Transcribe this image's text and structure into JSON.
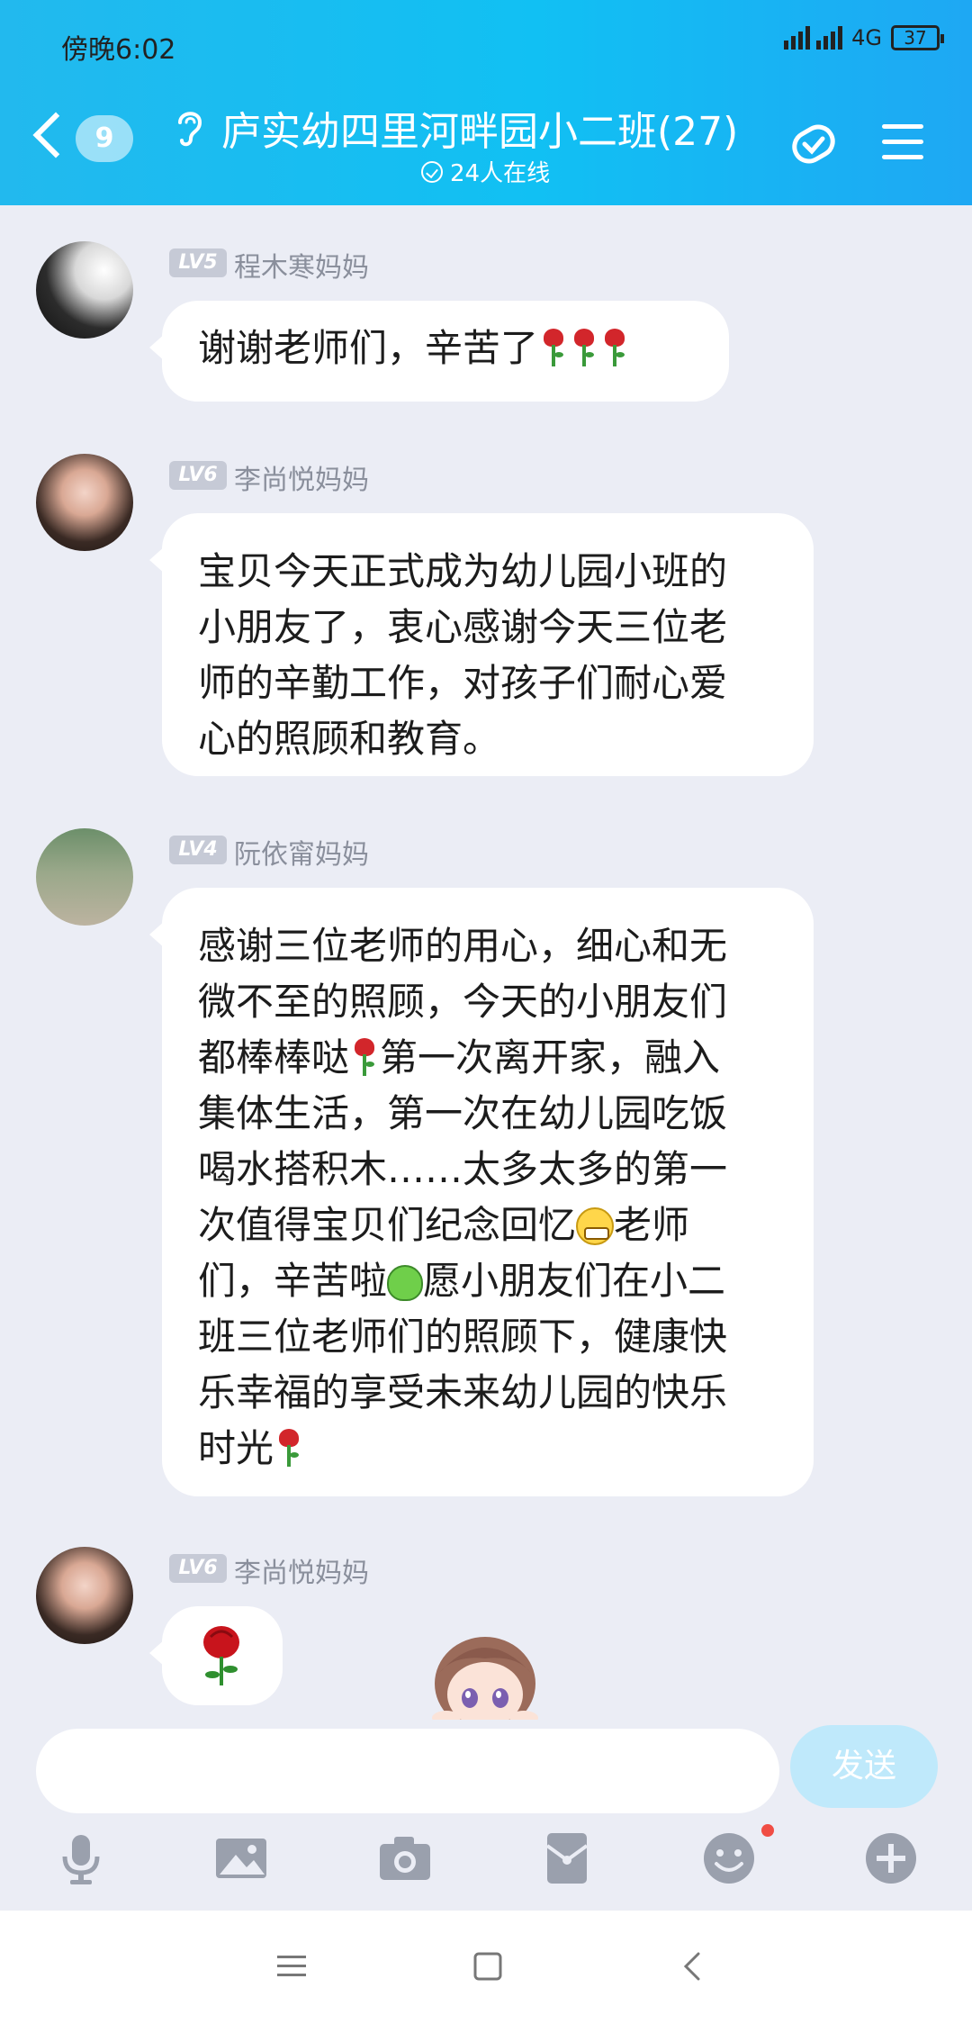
{
  "status_bar": {
    "time": "傍晚6:02",
    "network": "4G",
    "battery": "37"
  },
  "header": {
    "back_count": "9",
    "title": "庐实幼四里河畔园小二班(27)",
    "online": "24人在线"
  },
  "messages": [
    {
      "level": "LV5",
      "sender": "程木寒妈妈",
      "text_parts": [
        "谢谢老师们，辛苦了"
      ]
    },
    {
      "level": "LV6",
      "sender": "李尚悦妈妈",
      "lines": [
        "宝贝今天正式成为幼儿园小班的",
        "小朋友了，衷心感谢今天三位老",
        "师的辛勤工作，对孩子们耐心爱",
        "心的照顾和教育。"
      ]
    },
    {
      "level": "LV4",
      "sender": "阮依甯妈妈",
      "lines": [
        "感谢三位老师的用心，细心和无",
        "微不至的照顾，今天的小朋友们",
        "都棒棒哒",
        "第一次离开家，融入",
        "集体生活，第一次在幼儿园吃饭",
        "喝水搭积木……太多太多的第一",
        "次值得宝贝们纪念回忆",
        "老师",
        "们，辛苦啦",
        "愿小朋友们在小二",
        "班三位老师们的照顾下，健康快",
        "乐幸福的享受未来幼儿园的快乐",
        "时光"
      ]
    },
    {
      "level": "LV6",
      "sender": "李尚悦妈妈"
    }
  ],
  "input": {
    "placeholder": "",
    "send_label": "发送"
  },
  "toolbar_icons": [
    "microphone-icon",
    "image-icon",
    "camera-icon",
    "red-packet-icon",
    "emoji-icon",
    "plus-icon"
  ],
  "colors": {
    "header": "#11c0f3",
    "background": "#ebedf5",
    "send_disabled": "#bfe9fb",
    "level_badge": "#c6cad6"
  }
}
